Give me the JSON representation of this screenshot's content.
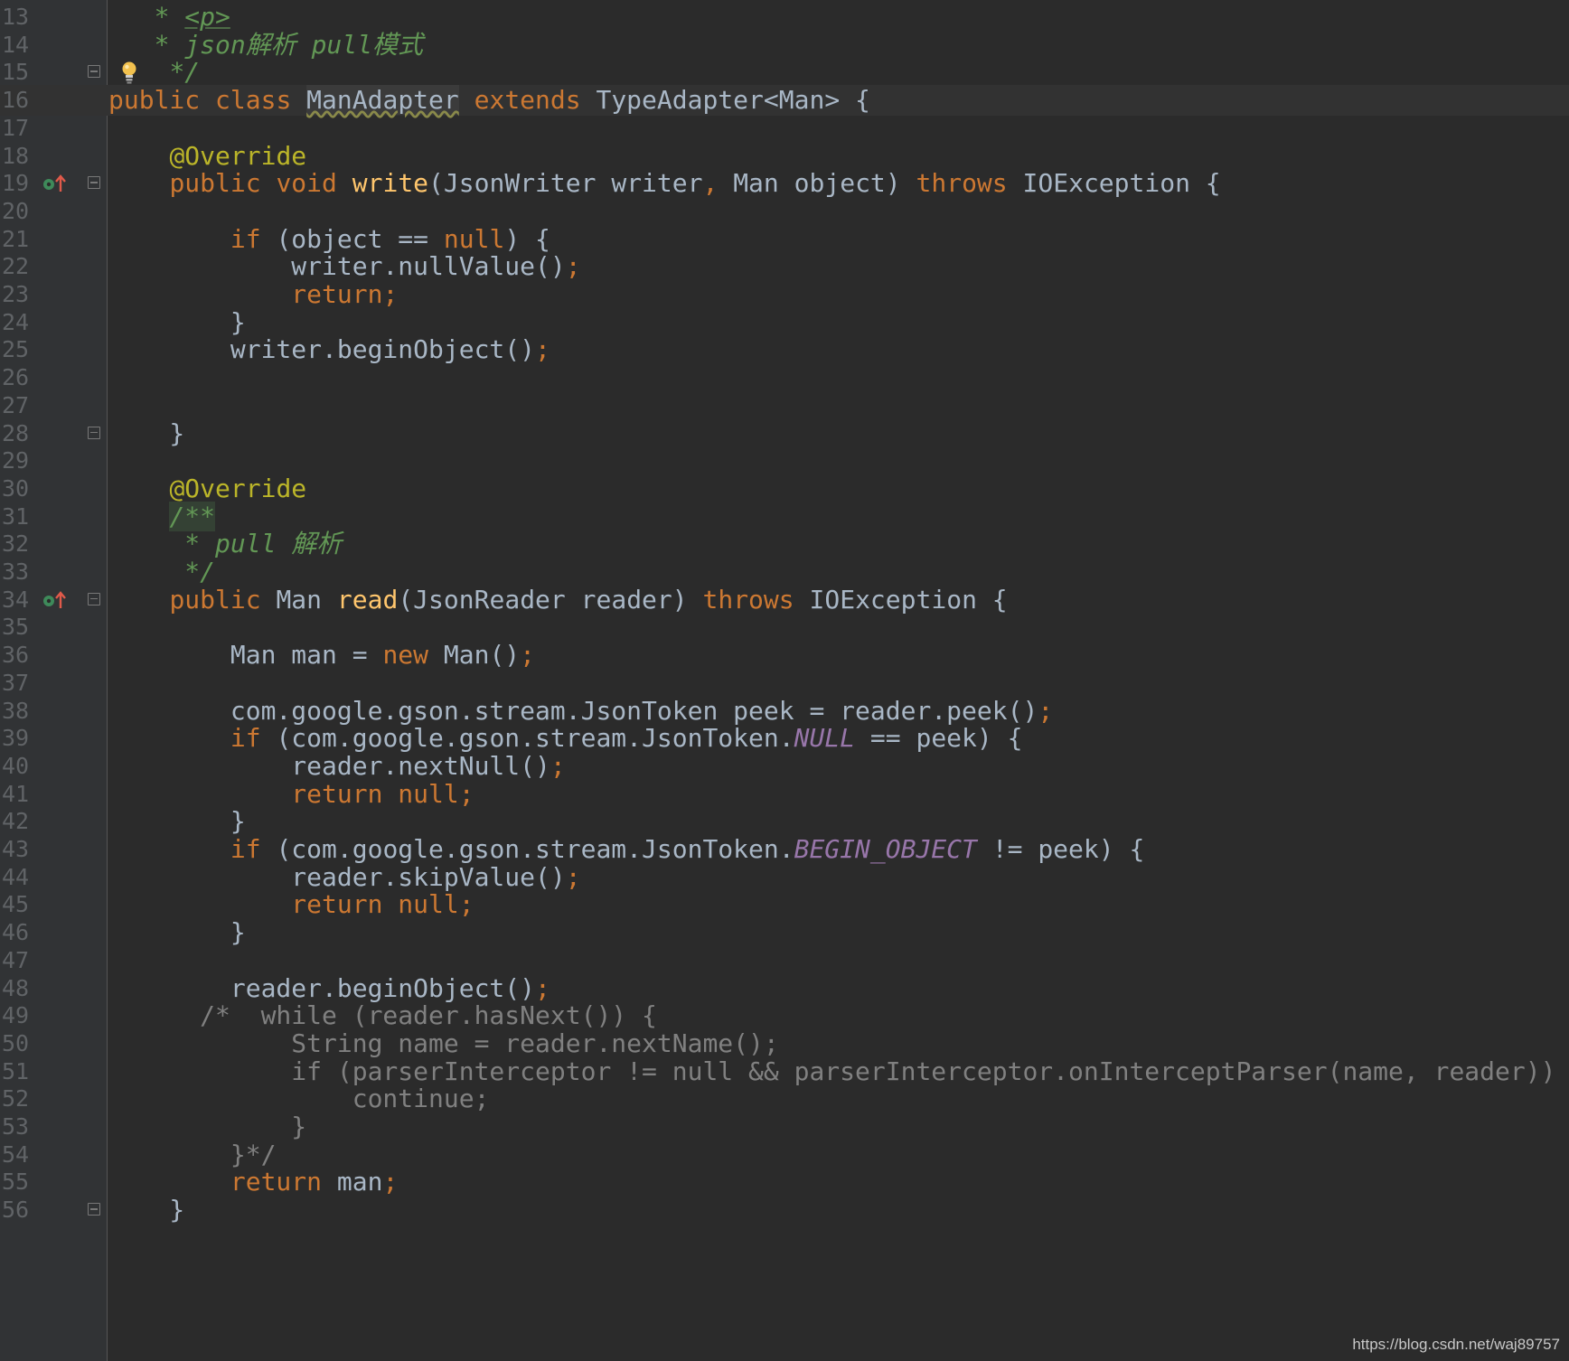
{
  "editor": {
    "language": "java",
    "lines": [
      {
        "num": "13",
        "tokens": [
          {
            "t": "   * ",
            "c": "doc"
          },
          {
            "t": "<p>",
            "c": "doctag"
          }
        ]
      },
      {
        "num": "14",
        "tokens": [
          {
            "t": "   * json解析 pull模式",
            "c": "doc"
          }
        ]
      },
      {
        "num": "15",
        "fold": true,
        "bulb": true,
        "tokens": [
          {
            "t": "    ",
            "c": "plain"
          },
          {
            "t": "*/",
            "c": "doc"
          }
        ]
      },
      {
        "num": "16",
        "current": true,
        "tokens": [
          {
            "t": "public ",
            "c": "kw"
          },
          {
            "t": "class ",
            "c": "kw"
          },
          {
            "t": "ManAdapter",
            "c": "cls-warn"
          },
          {
            "t": " ",
            "c": "plain"
          },
          {
            "t": "extends ",
            "c": "kw"
          },
          {
            "t": "TypeAdapter<Man> {",
            "c": "plain"
          }
        ]
      },
      {
        "num": "17",
        "tokens": []
      },
      {
        "num": "18",
        "tokens": [
          {
            "t": "    ",
            "c": "plain"
          },
          {
            "t": "@Override",
            "c": "anno"
          }
        ]
      },
      {
        "num": "19",
        "fold": true,
        "override": true,
        "tokens": [
          {
            "t": "    ",
            "c": "plain"
          },
          {
            "t": "public ",
            "c": "kw"
          },
          {
            "t": "void ",
            "c": "kw"
          },
          {
            "t": "write",
            "c": "method"
          },
          {
            "t": "(JsonWriter writer",
            "c": "plain"
          },
          {
            "t": ", ",
            "c": "kw"
          },
          {
            "t": "Man object) ",
            "c": "plain"
          },
          {
            "t": "throws ",
            "c": "kw"
          },
          {
            "t": "IOException {",
            "c": "plain"
          }
        ]
      },
      {
        "num": "20",
        "tokens": []
      },
      {
        "num": "21",
        "tokens": [
          {
            "t": "        ",
            "c": "plain"
          },
          {
            "t": "if ",
            "c": "kw"
          },
          {
            "t": "(object == ",
            "c": "plain"
          },
          {
            "t": "null",
            "c": "kw"
          },
          {
            "t": ") {",
            "c": "plain"
          }
        ]
      },
      {
        "num": "22",
        "tokens": [
          {
            "t": "            writer.nullValue()",
            "c": "plain"
          },
          {
            "t": ";",
            "c": "kw"
          }
        ]
      },
      {
        "num": "23",
        "tokens": [
          {
            "t": "            ",
            "c": "plain"
          },
          {
            "t": "return;",
            "c": "kw"
          }
        ]
      },
      {
        "num": "24",
        "tokens": [
          {
            "t": "        }",
            "c": "plain"
          }
        ]
      },
      {
        "num": "25",
        "tokens": [
          {
            "t": "        writer.beginObject()",
            "c": "plain"
          },
          {
            "t": ";",
            "c": "kw"
          }
        ]
      },
      {
        "num": "26",
        "tokens": []
      },
      {
        "num": "27",
        "tokens": []
      },
      {
        "num": "28",
        "fold": true,
        "tokens": [
          {
            "t": "    }",
            "c": "plain"
          }
        ]
      },
      {
        "num": "29",
        "tokens": []
      },
      {
        "num": "30",
        "tokens": [
          {
            "t": "    ",
            "c": "plain"
          },
          {
            "t": "@Override",
            "c": "anno"
          }
        ]
      },
      {
        "num": "31",
        "tokens": [
          {
            "t": "    ",
            "c": "plain"
          },
          {
            "t": "/**",
            "c": "doc-hl"
          }
        ]
      },
      {
        "num": "32",
        "tokens": [
          {
            "t": "     * pull 解析",
            "c": "doc"
          }
        ]
      },
      {
        "num": "33",
        "tokens": [
          {
            "t": "     */",
            "c": "doc"
          }
        ]
      },
      {
        "num": "34",
        "fold": true,
        "override": true,
        "tokens": [
          {
            "t": "    ",
            "c": "plain"
          },
          {
            "t": "public ",
            "c": "kw"
          },
          {
            "t": "Man ",
            "c": "plain"
          },
          {
            "t": "read",
            "c": "method"
          },
          {
            "t": "(JsonReader reader) ",
            "c": "plain"
          },
          {
            "t": "throws ",
            "c": "kw"
          },
          {
            "t": "IOException {",
            "c": "plain"
          }
        ]
      },
      {
        "num": "35",
        "tokens": []
      },
      {
        "num": "36",
        "tokens": [
          {
            "t": "        Man man = ",
            "c": "plain"
          },
          {
            "t": "new ",
            "c": "kw"
          },
          {
            "t": "Man()",
            "c": "plain"
          },
          {
            "t": ";",
            "c": "kw"
          }
        ]
      },
      {
        "num": "37",
        "tokens": []
      },
      {
        "num": "38",
        "tokens": [
          {
            "t": "        com.google.gson.stream.JsonToken peek = reader.peek()",
            "c": "plain"
          },
          {
            "t": ";",
            "c": "kw"
          }
        ]
      },
      {
        "num": "39",
        "tokens": [
          {
            "t": "        ",
            "c": "plain"
          },
          {
            "t": "if ",
            "c": "kw"
          },
          {
            "t": "(com.google.gson.stream.JsonToken.",
            "c": "plain"
          },
          {
            "t": "NULL",
            "c": "const"
          },
          {
            "t": " == peek) {",
            "c": "plain"
          }
        ]
      },
      {
        "num": "40",
        "tokens": [
          {
            "t": "            reader.nextNull()",
            "c": "plain"
          },
          {
            "t": ";",
            "c": "kw"
          }
        ]
      },
      {
        "num": "41",
        "tokens": [
          {
            "t": "            ",
            "c": "plain"
          },
          {
            "t": "return null;",
            "c": "kw"
          }
        ]
      },
      {
        "num": "42",
        "tokens": [
          {
            "t": "        }",
            "c": "plain"
          }
        ]
      },
      {
        "num": "43",
        "tokens": [
          {
            "t": "        ",
            "c": "plain"
          },
          {
            "t": "if ",
            "c": "kw"
          },
          {
            "t": "(com.google.gson.stream.JsonToken.",
            "c": "plain"
          },
          {
            "t": "BEGIN_OBJECT",
            "c": "const"
          },
          {
            "t": " != peek) {",
            "c": "plain"
          }
        ]
      },
      {
        "num": "44",
        "tokens": [
          {
            "t": "            reader.skipValue()",
            "c": "plain"
          },
          {
            "t": ";",
            "c": "kw"
          }
        ]
      },
      {
        "num": "45",
        "tokens": [
          {
            "t": "            ",
            "c": "plain"
          },
          {
            "t": "return null;",
            "c": "kw"
          }
        ]
      },
      {
        "num": "46",
        "tokens": [
          {
            "t": "        }",
            "c": "plain"
          }
        ]
      },
      {
        "num": "47",
        "tokens": []
      },
      {
        "num": "48",
        "tokens": [
          {
            "t": "        reader.beginObject()",
            "c": "plain"
          },
          {
            "t": ";",
            "c": "kw"
          }
        ]
      },
      {
        "num": "49",
        "tokens": [
          {
            "t": "      /*  while (reader.hasNext()) {",
            "c": "comment"
          }
        ]
      },
      {
        "num": "50",
        "tokens": [
          {
            "t": "            String name = reader.nextName();",
            "c": "comment"
          }
        ]
      },
      {
        "num": "51",
        "tokens": [
          {
            "t": "            if (parserInterceptor != null && parserInterceptor.onInterceptParser(name, reader)) {",
            "c": "comment"
          }
        ]
      },
      {
        "num": "52",
        "tokens": [
          {
            "t": "                continue;",
            "c": "comment"
          }
        ]
      },
      {
        "num": "53",
        "tokens": [
          {
            "t": "            }",
            "c": "comment"
          }
        ]
      },
      {
        "num": "54",
        "tokens": [
          {
            "t": "        }*/",
            "c": "comment"
          }
        ]
      },
      {
        "num": "55",
        "tokens": [
          {
            "t": "        ",
            "c": "plain"
          },
          {
            "t": "return ",
            "c": "kw"
          },
          {
            "t": "man",
            "c": "plain"
          },
          {
            "t": ";",
            "c": "kw"
          }
        ]
      },
      {
        "num": "56",
        "fold": true,
        "tokens": [
          {
            "t": "    }",
            "c": "plain"
          }
        ]
      }
    ]
  },
  "colors": {
    "background": "#2b2b2b",
    "gutter": "#313335",
    "keyword": "#cc7832",
    "annotation": "#bbb529",
    "method": "#ffc66d",
    "constant": "#9876aa",
    "doc_comment": "#629755",
    "line_comment": "#808080",
    "text": "#a9b7c6"
  },
  "watermark": "https://blog.csdn.net/waj89757"
}
